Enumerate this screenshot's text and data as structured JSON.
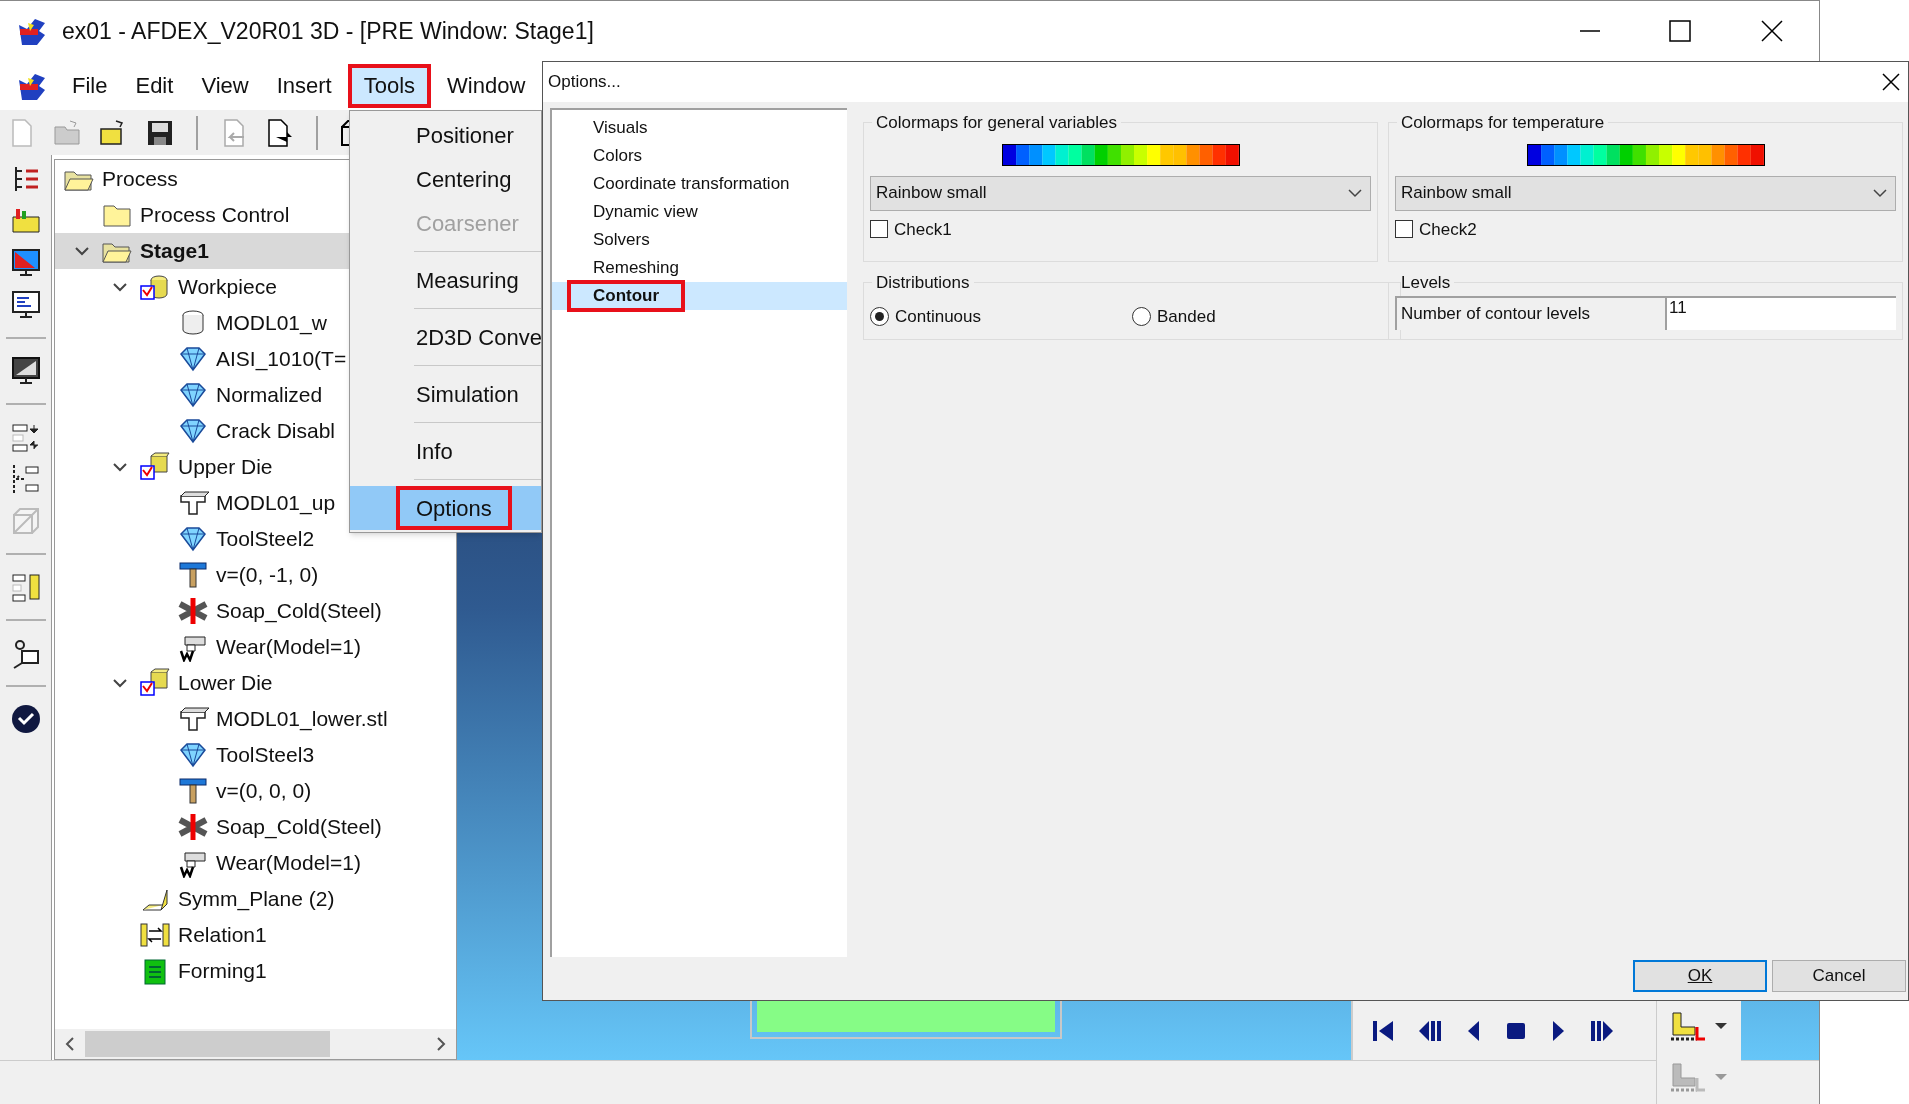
{
  "window": {
    "title": "ex01 - AFDEX_V20R01 3D - [PRE Window: Stage1]"
  },
  "menu_bar": [
    {
      "label": "File",
      "selected": false
    },
    {
      "label": "Edit",
      "selected": false
    },
    {
      "label": "View",
      "selected": false
    },
    {
      "label": "Insert",
      "selected": false
    },
    {
      "label": "Tools",
      "selected": true
    },
    {
      "label": "Window",
      "selected": false
    }
  ],
  "tools_menu": [
    {
      "kind": "item",
      "label": "Positioner",
      "disabled": false,
      "selected": false
    },
    {
      "kind": "item",
      "label": "Centering",
      "disabled": false,
      "selected": false
    },
    {
      "kind": "item",
      "label": "Coarsener",
      "disabled": true,
      "selected": false
    },
    {
      "kind": "separator"
    },
    {
      "kind": "item",
      "label": "Measuring",
      "disabled": false,
      "selected": false
    },
    {
      "kind": "separator"
    },
    {
      "kind": "item",
      "label": "2D3D Conve",
      "disabled": false,
      "selected": false
    },
    {
      "kind": "separator"
    },
    {
      "kind": "item",
      "label": "Simulation",
      "disabled": false,
      "selected": false
    },
    {
      "kind": "separator"
    },
    {
      "kind": "item",
      "label": "Info",
      "disabled": false,
      "selected": false
    },
    {
      "kind": "separator"
    },
    {
      "kind": "item",
      "label": "Options",
      "disabled": false,
      "selected": true
    }
  ],
  "tree": [
    {
      "label": "Process",
      "kind": "process",
      "selected": false,
      "children": [
        {
          "label": "Process Control",
          "kind": "control",
          "selected": false
        },
        {
          "label": "Stage1",
          "kind": "stage",
          "selected": true,
          "expanded": true,
          "children": [
            {
              "label": "Workpiece",
              "kind": "workpiece",
              "selected": false,
              "expanded": true,
              "children": [
                {
                  "label": "MODL01_w",
                  "kind": "cylinder",
                  "selected": false
                },
                {
                  "label": "AISI_1010(T=",
                  "kind": "material",
                  "selected": false
                },
                {
                  "label": "Normalized",
                  "kind": "material",
                  "selected": false
                },
                {
                  "label": "Crack Disabl",
                  "kind": "material",
                  "selected": false
                }
              ]
            },
            {
              "label": "Upper Die",
              "kind": "upper-die",
              "selected": false,
              "expanded": true,
              "children": [
                {
                  "label": "MODL01_up",
                  "kind": "tool",
                  "selected": false
                },
                {
                  "label": "ToolSteel2",
                  "kind": "material",
                  "selected": false
                },
                {
                  "label": "v=(0, -1, 0)",
                  "kind": "velocity",
                  "selected": false
                },
                {
                  "label": "Soap_Cold(Steel)",
                  "kind": "lubricant",
                  "selected": false
                },
                {
                  "label": "Wear(Model=1)",
                  "kind": "wear",
                  "selected": false
                }
              ]
            },
            {
              "label": "Lower Die",
              "kind": "lower-die",
              "selected": false,
              "expanded": true,
              "children": [
                {
                  "label": "MODL01_lower.stl",
                  "kind": "tool",
                  "selected": false
                },
                {
                  "label": "ToolSteel3",
                  "kind": "material",
                  "selected": false
                },
                {
                  "label": "v=(0, 0, 0)",
                  "kind": "velocity",
                  "selected": false
                },
                {
                  "label": "Soap_Cold(Steel)",
                  "kind": "lubricant",
                  "selected": false
                },
                {
                  "label": "Wear(Model=1)",
                  "kind": "wear",
                  "selected": false
                }
              ]
            },
            {
              "label": "Symm_Plane (2)",
              "kind": "plane",
              "selected": false
            },
            {
              "label": "Relation1",
              "kind": "relation",
              "selected": false
            },
            {
              "label": "Forming1",
              "kind": "forming",
              "selected": false
            }
          ]
        }
      ]
    }
  ],
  "options_dialog": {
    "title": "Options...",
    "pages": [
      {
        "label": "Visuals",
        "selected": false
      },
      {
        "label": "Colors",
        "selected": false
      },
      {
        "label": "Coordinate transformation",
        "selected": false
      },
      {
        "label": "Dynamic view",
        "selected": false
      },
      {
        "label": "Solvers",
        "selected": false
      },
      {
        "label": "Remeshing",
        "selected": false
      },
      {
        "label": "Contour",
        "selected": true
      }
    ],
    "colormap_groups": [
      {
        "legend": "Colormaps for general variables",
        "colormap": "Rainbow small",
        "checkbox": {
          "label": "Check1",
          "checked": false
        }
      },
      {
        "legend": "Colormaps for temperature",
        "colormap": "Rainbow small",
        "checkbox": {
          "label": "Check2",
          "checked": false
        }
      }
    ],
    "distributions": {
      "legend": "Distributions",
      "options": [
        {
          "label": "Continuous",
          "selected": true
        },
        {
          "label": "Banded",
          "selected": false
        }
      ]
    },
    "levels": {
      "legend": "Levels",
      "label": "Number of contour levels",
      "value": "11"
    },
    "buttons": [
      {
        "label": "OK",
        "default": true
      },
      {
        "label": "Cancel",
        "default": false
      }
    ]
  }
}
